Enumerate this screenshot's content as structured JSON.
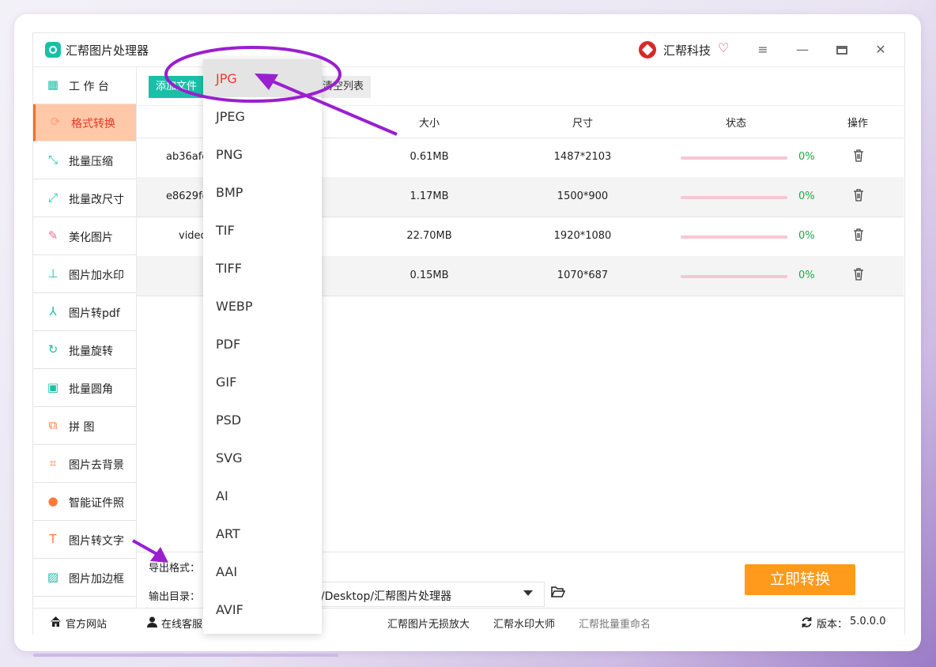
{
  "app": {
    "title": "汇帮图片处理器",
    "brand": "汇帮科技"
  },
  "sidebar": {
    "items": [
      {
        "label": "工 作 台",
        "icon": "grid-icon",
        "active": false
      },
      {
        "label": "格式转换",
        "icon": "convert-icon",
        "active": true
      },
      {
        "label": "批量压缩",
        "icon": "compress-icon",
        "active": false
      },
      {
        "label": "批量改尺寸",
        "icon": "resize-icon",
        "active": false
      },
      {
        "label": "美化图片",
        "icon": "beautify-icon",
        "active": false
      },
      {
        "label": "图片加水印",
        "icon": "stamp-icon",
        "active": false
      },
      {
        "label": "图片转pdf",
        "icon": "pdf-icon",
        "active": false
      },
      {
        "label": "批量旋转",
        "icon": "rotate-icon",
        "active": false
      },
      {
        "label": "批量圆角",
        "icon": "image-icon",
        "active": false
      },
      {
        "label": "拼    图",
        "icon": "puzzle-icon",
        "active": false
      },
      {
        "label": "图片去背景",
        "icon": "crop-icon",
        "active": false
      },
      {
        "label": "智能证件照",
        "icon": "person-icon",
        "active": false
      },
      {
        "label": "图片转文字",
        "icon": "text-icon",
        "active": false
      },
      {
        "label": "图片加边框",
        "icon": "frame-icon",
        "active": false
      }
    ]
  },
  "toolbar": {
    "add_label": "添加文件",
    "clear_label": "清空列表"
  },
  "table": {
    "headers": {
      "size": "大小",
      "dimensions": "尺寸",
      "status": "状态",
      "actions": "操作"
    },
    "rows": [
      {
        "name": "ab36afe",
        "size": "0.61MB",
        "dims": "1487*2103",
        "progress": "0%"
      },
      {
        "name": "e8629fd",
        "size": "1.17MB",
        "dims": "1500*900",
        "progress": "0%"
      },
      {
        "name": "video",
        "size": "22.70MB",
        "dims": "1920*1080",
        "progress": "0%"
      },
      {
        "name": "",
        "size": "0.15MB",
        "dims": "1070*687",
        "progress": "0%"
      }
    ]
  },
  "export": {
    "format_label": "导出格式：",
    "outdir_label": "输出目录：",
    "outdir_value": "3/Desktop/汇帮图片处理器"
  },
  "convert_label": "立即转换",
  "format_menu": {
    "selected": "JPG",
    "options": [
      "JPG",
      "JPEG",
      "PNG",
      "BMP",
      "TIF",
      "TIFF",
      "WEBP",
      "PDF",
      "GIF",
      "PSD",
      "SVG",
      "AI",
      "ART",
      "AAI",
      "AVIF"
    ]
  },
  "statusbar": {
    "website": "官方网站",
    "support": "在线客服",
    "link1": "汇帮图片无损放大",
    "link2": "汇帮水印大师",
    "link3": "汇帮批量重命名",
    "version_label": "版本：",
    "version_value": "5.0.0.0"
  },
  "colors": {
    "accent": "#19c0a8",
    "active_bg": "#ffc8a8",
    "active_text": "#e8392a",
    "convert": "#ff9a1a",
    "annotation": "#9a1fd0"
  }
}
